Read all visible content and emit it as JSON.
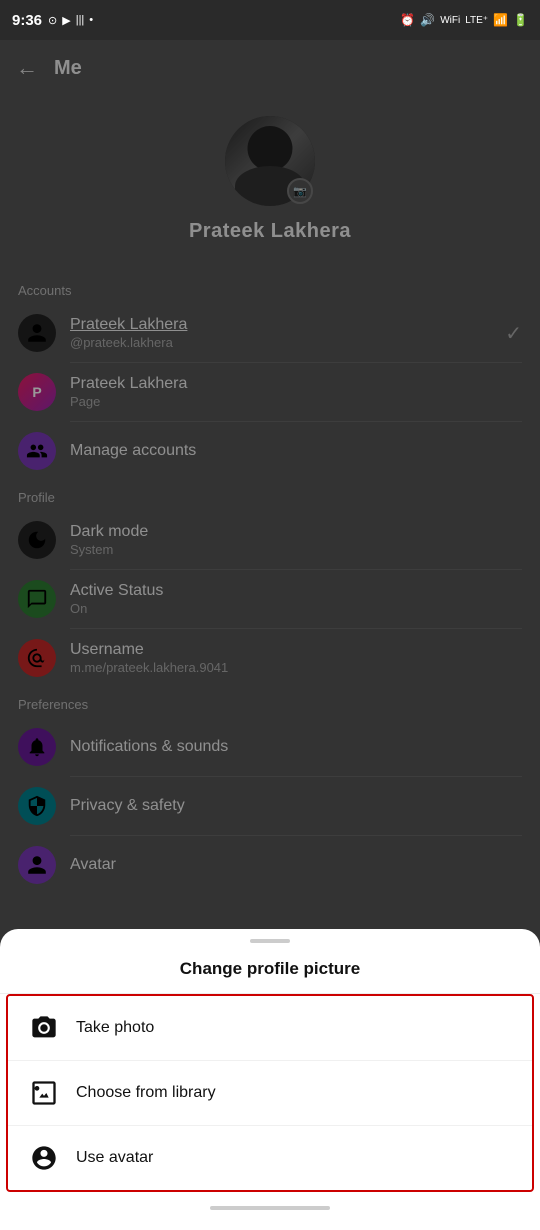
{
  "statusBar": {
    "time": "9:36",
    "leftIcons": [
      "instagram",
      "youtube",
      "signal-bars",
      "circle"
    ],
    "rightIcons": [
      "alarm",
      "volume",
      "wifi-lte",
      "signal",
      "lte",
      "signal-strength",
      "battery"
    ]
  },
  "header": {
    "backLabel": "←",
    "title": "Me"
  },
  "profile": {
    "name": "Prateek Lakhera",
    "editBadge": "📷"
  },
  "accounts": {
    "sectionLabel": "Accounts",
    "items": [
      {
        "title": "Prateek Lakhera",
        "subtitle": "@prateek.lakhera",
        "hasCheck": true
      },
      {
        "title": "Prateek Lakhera",
        "subtitle": "Page",
        "hasCheck": false
      },
      {
        "title": "Manage accounts",
        "subtitle": "",
        "hasCheck": false
      }
    ]
  },
  "profile_section": {
    "sectionLabel": "Profile",
    "items": [
      {
        "title": "Dark mode",
        "subtitle": "System"
      },
      {
        "title": "Active Status",
        "subtitle": "On"
      },
      {
        "title": "Username",
        "subtitle": "m.me/prateek.lakhera.9041"
      }
    ]
  },
  "preferences": {
    "sectionLabel": "Preferences",
    "items": [
      {
        "title": "Notifications & sounds",
        "subtitle": ""
      },
      {
        "title": "Privacy & safety",
        "subtitle": ""
      },
      {
        "title": "Avatar",
        "subtitle": ""
      }
    ]
  },
  "bottomSheet": {
    "title": "Change profile picture",
    "actions": [
      {
        "id": "take-photo",
        "label": "Take photo",
        "icon": "camera"
      },
      {
        "id": "choose-library",
        "label": "Choose from library",
        "icon": "gallery"
      },
      {
        "id": "use-avatar",
        "label": "Use avatar",
        "icon": "avatar"
      }
    ]
  }
}
